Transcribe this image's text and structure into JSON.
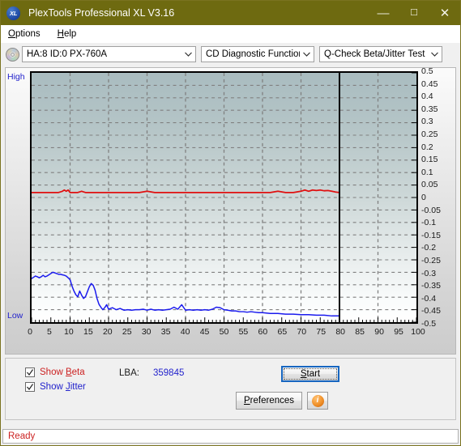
{
  "window": {
    "title": "PlexTools Professional XL V3.16",
    "app_icon": "XL",
    "minimize": "—",
    "maximize": "☐",
    "close": "✕"
  },
  "menubar": {
    "items": [
      {
        "label": "Options",
        "accel": "O"
      },
      {
        "label": "Help",
        "accel": "H"
      }
    ]
  },
  "toolbar": {
    "drive_combo": "HA:8 ID:0  PX-760A",
    "function_combo": "CD Diagnostic Functions",
    "test_combo": "Q-Check Beta/Jitter Test"
  },
  "controls": {
    "show_beta_label": "Show Beta",
    "show_jitter_label": "Show Jitter",
    "show_beta_checked": true,
    "show_jitter_checked": true,
    "lba_label": "LBA:",
    "lba_value": "359845",
    "start_label": "Start",
    "preferences_label": "Preferences",
    "info_glyph": "i"
  },
  "statusbar": {
    "text": "Ready"
  },
  "colors": {
    "titlebar": "#6e6a10",
    "beta_series": "#e01010",
    "jitter_series": "#1a1aee",
    "axis_text_blue": "#2222cc",
    "status_text": "#cc2222",
    "plot_border": "#000000",
    "gridline": "#808080"
  },
  "chart_data": {
    "type": "line",
    "title": "",
    "xlabel": "",
    "ylabel": "",
    "xlim": [
      0,
      100
    ],
    "ylim": [
      -0.5,
      0.5
    ],
    "grid": true,
    "grid_style": "dashed",
    "legend_position": "bottom-left-checkboxes",
    "y_axis_side": "right",
    "y_ticks": [
      0.5,
      0.45,
      0.4,
      0.35,
      0.3,
      0.25,
      0.2,
      0.15,
      0.1,
      0.05,
      0,
      -0.05,
      -0.1,
      -0.15,
      -0.2,
      -0.25,
      -0.3,
      -0.35,
      -0.4,
      -0.45,
      -0.5
    ],
    "y_tick_labels": [
      "0.5",
      "0.45",
      "0.4",
      "0.35",
      "0.3",
      "0.25",
      "0.2",
      "0.15",
      "0.1",
      "0.05",
      "0",
      "-0.05",
      "-0.1",
      "-0.15",
      "-0.2",
      "-0.25",
      "-0.3",
      "-0.35",
      "-0.4",
      "-0.45",
      "-0.5"
    ],
    "x_ticks": [
      0,
      5,
      10,
      15,
      20,
      25,
      30,
      35,
      40,
      45,
      50,
      55,
      60,
      65,
      70,
      75,
      80,
      85,
      90,
      95,
      100
    ],
    "x_tick_labels": [
      "0",
      "5",
      "10",
      "15",
      "20",
      "25",
      "30",
      "35",
      "40",
      "45",
      "50",
      "55",
      "60",
      "65",
      "70",
      "75",
      "80",
      "85",
      "90",
      "95",
      "100"
    ],
    "left_axis_annotations": {
      "top": "High",
      "bottom": "Low"
    },
    "data_end_marker_x": 80,
    "series": [
      {
        "name": "Beta",
        "color": "#e01010",
        "x": [
          0,
          1,
          2,
          3,
          4,
          5,
          6,
          7,
          8,
          8.5,
          9,
          9.5,
          10,
          11,
          12,
          13,
          14,
          15,
          16,
          17,
          18,
          19,
          20,
          22,
          24,
          26,
          28,
          30,
          32,
          34,
          36,
          38,
          40,
          42,
          44,
          46,
          48,
          50,
          52,
          54,
          56,
          58,
          60,
          62,
          64,
          66,
          68,
          70,
          71,
          72,
          73,
          74,
          75,
          76,
          77,
          78,
          79,
          80
        ],
        "values": [
          0.02,
          0.02,
          0.02,
          0.02,
          0.02,
          0.02,
          0.02,
          0.02,
          0.025,
          0.03,
          0.025,
          0.03,
          0.02,
          0.02,
          0.02,
          0.025,
          0.02,
          0.02,
          0.02,
          0.02,
          0.02,
          0.02,
          0.02,
          0.02,
          0.02,
          0.02,
          0.02,
          0.025,
          0.02,
          0.02,
          0.02,
          0.02,
          0.02,
          0.02,
          0.02,
          0.02,
          0.02,
          0.02,
          0.02,
          0.02,
          0.02,
          0.02,
          0.02,
          0.02,
          0.025,
          0.02,
          0.02,
          0.025,
          0.03,
          0.025,
          0.03,
          0.028,
          0.03,
          0.027,
          0.028,
          0.025,
          0.022,
          0.02
        ]
      },
      {
        "name": "Jitter",
        "color": "#1a1aee",
        "x": [
          0,
          0.5,
          1,
          1.5,
          2,
          2.5,
          3,
          3.5,
          4,
          4.5,
          5,
          5.5,
          6,
          6.5,
          7,
          7.5,
          8,
          8.5,
          9,
          9.5,
          10,
          10.5,
          11,
          11.5,
          12,
          12.5,
          13,
          13.5,
          14,
          14.5,
          15,
          15.5,
          16,
          16.5,
          17,
          17.5,
          18,
          18.5,
          19,
          19.5,
          20,
          21,
          22,
          23,
          24,
          25,
          26,
          27,
          28,
          29,
          30,
          31,
          32,
          33,
          34,
          35,
          36,
          37,
          38,
          39,
          40,
          41,
          42,
          43,
          44,
          45,
          46,
          47,
          48,
          49,
          50,
          51,
          52,
          53,
          54,
          55,
          56,
          57,
          58,
          59,
          60,
          62,
          64,
          66,
          68,
          70,
          72,
          74,
          76,
          78,
          80
        ],
        "values": [
          -0.325,
          -0.32,
          -0.315,
          -0.318,
          -0.322,
          -0.318,
          -0.312,
          -0.318,
          -0.315,
          -0.31,
          -0.305,
          -0.3,
          -0.302,
          -0.305,
          -0.308,
          -0.308,
          -0.31,
          -0.312,
          -0.315,
          -0.322,
          -0.33,
          -0.355,
          -0.375,
          -0.39,
          -0.398,
          -0.375,
          -0.392,
          -0.405,
          -0.398,
          -0.378,
          -0.358,
          -0.345,
          -0.352,
          -0.372,
          -0.405,
          -0.428,
          -0.44,
          -0.45,
          -0.442,
          -0.43,
          -0.448,
          -0.442,
          -0.45,
          -0.445,
          -0.452,
          -0.45,
          -0.452,
          -0.45,
          -0.45,
          -0.448,
          -0.452,
          -0.448,
          -0.452,
          -0.45,
          -0.452,
          -0.45,
          -0.448,
          -0.44,
          -0.448,
          -0.43,
          -0.452,
          -0.45,
          -0.452,
          -0.45,
          -0.452,
          -0.45,
          -0.452,
          -0.448,
          -0.44,
          -0.442,
          -0.45,
          -0.452,
          -0.455,
          -0.455,
          -0.458,
          -0.458,
          -0.46,
          -0.458,
          -0.46,
          -0.462,
          -0.462,
          -0.465,
          -0.465,
          -0.468,
          -0.468,
          -0.47,
          -0.47,
          -0.472,
          -0.472,
          -0.475,
          -0.475
        ]
      }
    ]
  }
}
